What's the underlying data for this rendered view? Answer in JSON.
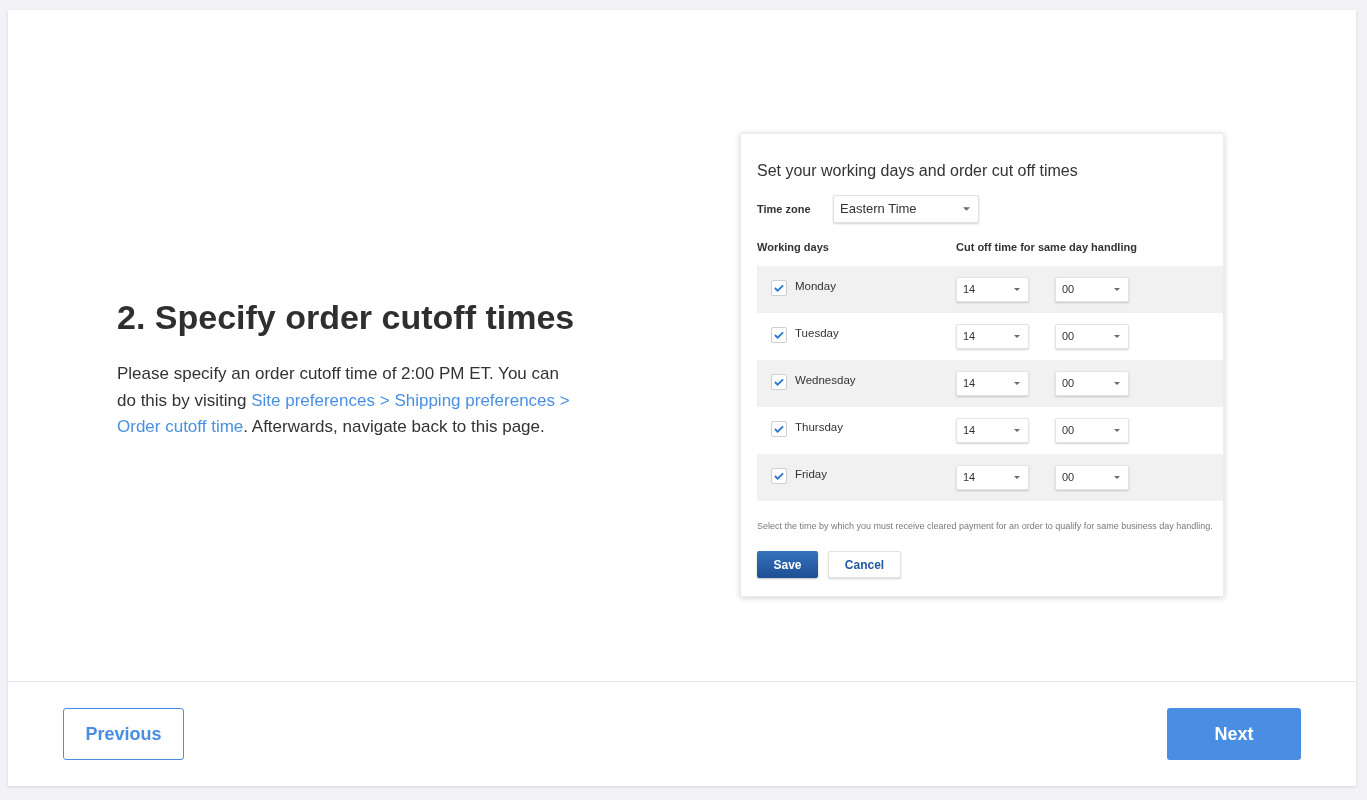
{
  "step": {
    "heading": "2. Specify order cutoff times",
    "description": [
      {
        "kind": "text",
        "text": "Please specify an order cutoff time of 2:00 PM ET. You can do this by visiting "
      },
      {
        "kind": "link",
        "text": "Site preferences >"
      },
      {
        "kind": "link",
        "text": "Shipping preferences >"
      },
      {
        "kind": "link",
        "text": "Order cutoff time"
      },
      {
        "kind": "text",
        "text": ". Afterwards, navigate back to this page."
      }
    ]
  },
  "screenshot": {
    "title": "Set your working days and order cut off times",
    "time_zone": {
      "label": "Time zone",
      "value": "Eastern Time"
    },
    "columns": [
      "Working days",
      "Cut off time for same day handling"
    ],
    "days": [
      {
        "name": "Monday",
        "checked": true,
        "hour": "14",
        "minute": "00"
      },
      {
        "name": "Tuesday",
        "checked": true,
        "hour": "14",
        "minute": "00"
      },
      {
        "name": "Wednesday",
        "checked": true,
        "hour": "14",
        "minute": "00"
      },
      {
        "name": "Thursday",
        "checked": true,
        "hour": "14",
        "minute": "00"
      },
      {
        "name": "Friday",
        "checked": true,
        "hour": "14",
        "minute": "00"
      }
    ],
    "note": "Select the time by which you must receive cleared payment for an order to qualify for same business day handling.",
    "buttons": [
      {
        "label": "Save",
        "kind": "primary"
      },
      {
        "label": "Cancel",
        "kind": "secondary"
      }
    ]
  },
  "footer": {
    "buttons": [
      {
        "label": "Previous",
        "kind": "secondary"
      },
      {
        "label": "Next",
        "kind": "primary"
      }
    ]
  }
}
